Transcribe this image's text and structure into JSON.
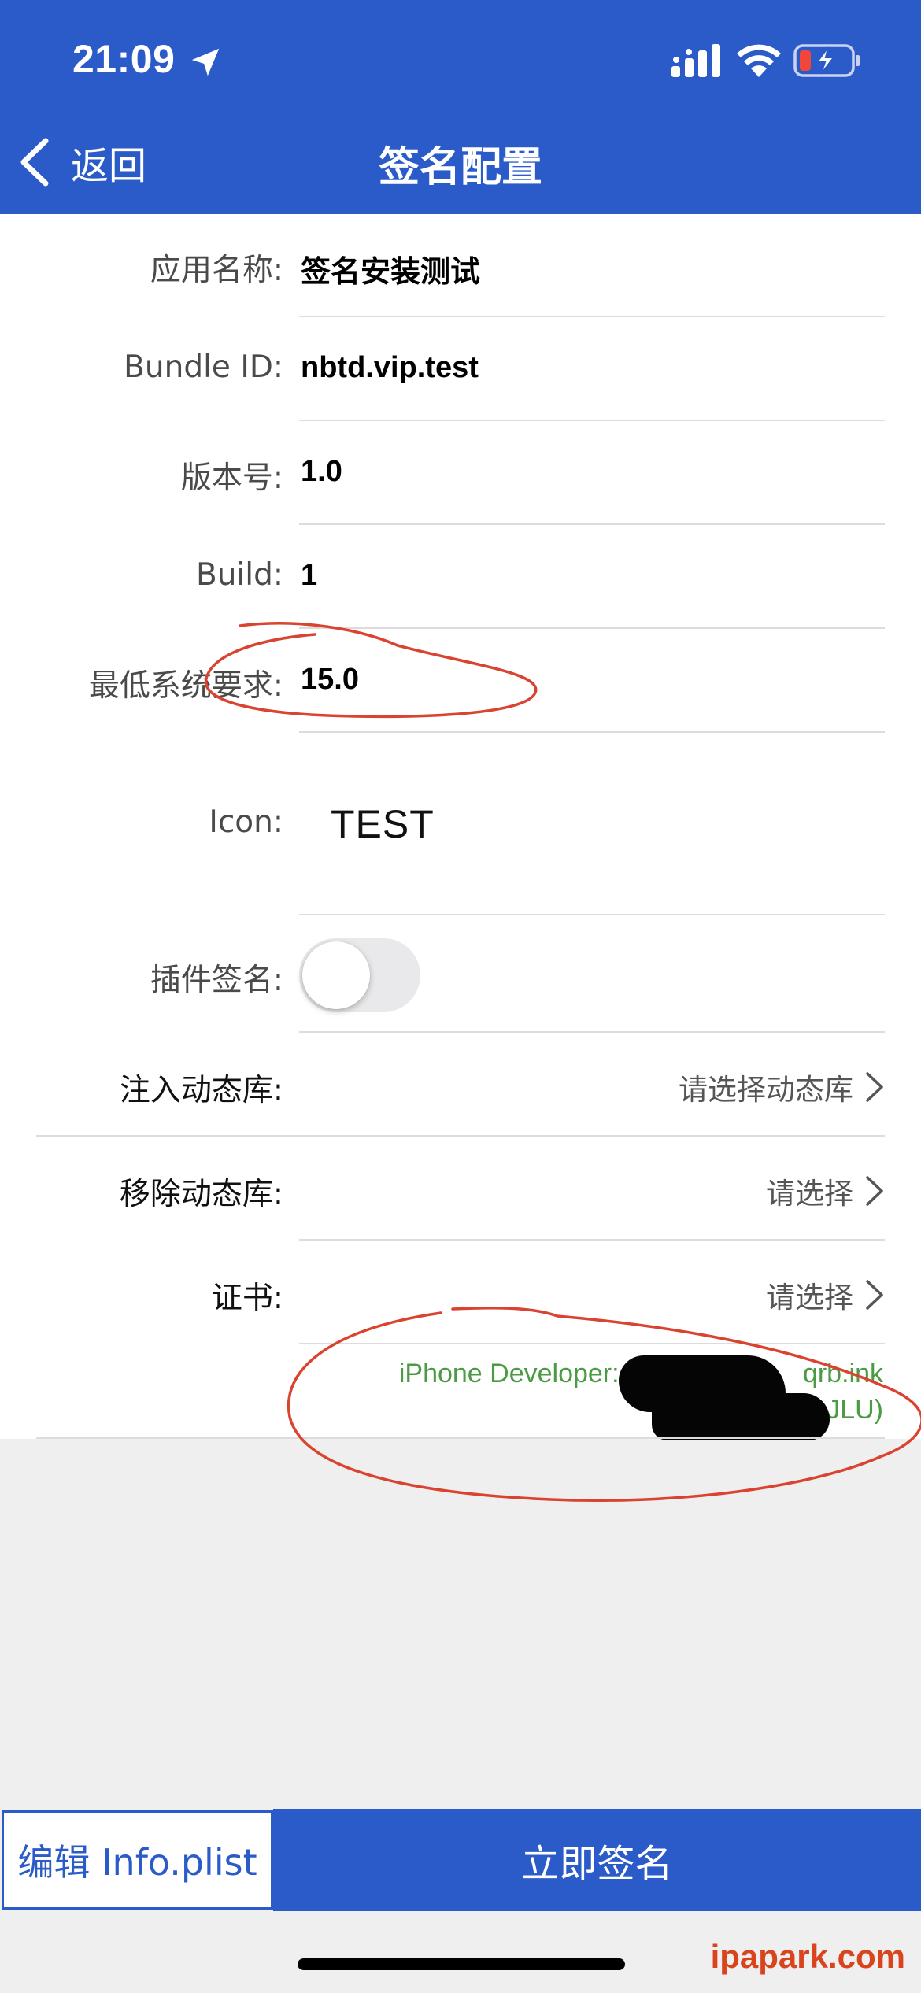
{
  "status_bar": {
    "time": "21:09"
  },
  "nav": {
    "back_label": "返回",
    "title": "签名配置"
  },
  "form": {
    "app_name": {
      "label": "应用名称:",
      "value": "签名安装测试"
    },
    "bundle_id": {
      "label": "Bundle ID:",
      "value": "nbtd.vip.test"
    },
    "version": {
      "label": "版本号:",
      "value": "1.0"
    },
    "build": {
      "label": "Build:",
      "value": "1"
    },
    "min_os": {
      "label": "最低系统要求:",
      "value": "15.0"
    },
    "icon": {
      "label": "Icon:",
      "value": "TEST"
    },
    "plugin_sign": {
      "label": "插件签名:",
      "enabled": false
    },
    "inject_dylib": {
      "label": "注入动态库:",
      "picker": "请选择动态库"
    },
    "remove_dylib": {
      "label": "移除动态库:",
      "picker": "请选择"
    },
    "certificate": {
      "label": "证书:",
      "picker": "请选择",
      "line1": "iPhone Developer: zh",
      "line1_end": "qrb.ink",
      "line2": "JLU)"
    }
  },
  "buttons": {
    "edit_plist": "编辑 Info.plist",
    "sign_now": "立即签名"
  },
  "watermark": "ipapark.com",
  "colors": {
    "brand_blue": "#2a5bc9",
    "cert_green": "#4b9b44",
    "annotation_red": "#d9432f"
  }
}
